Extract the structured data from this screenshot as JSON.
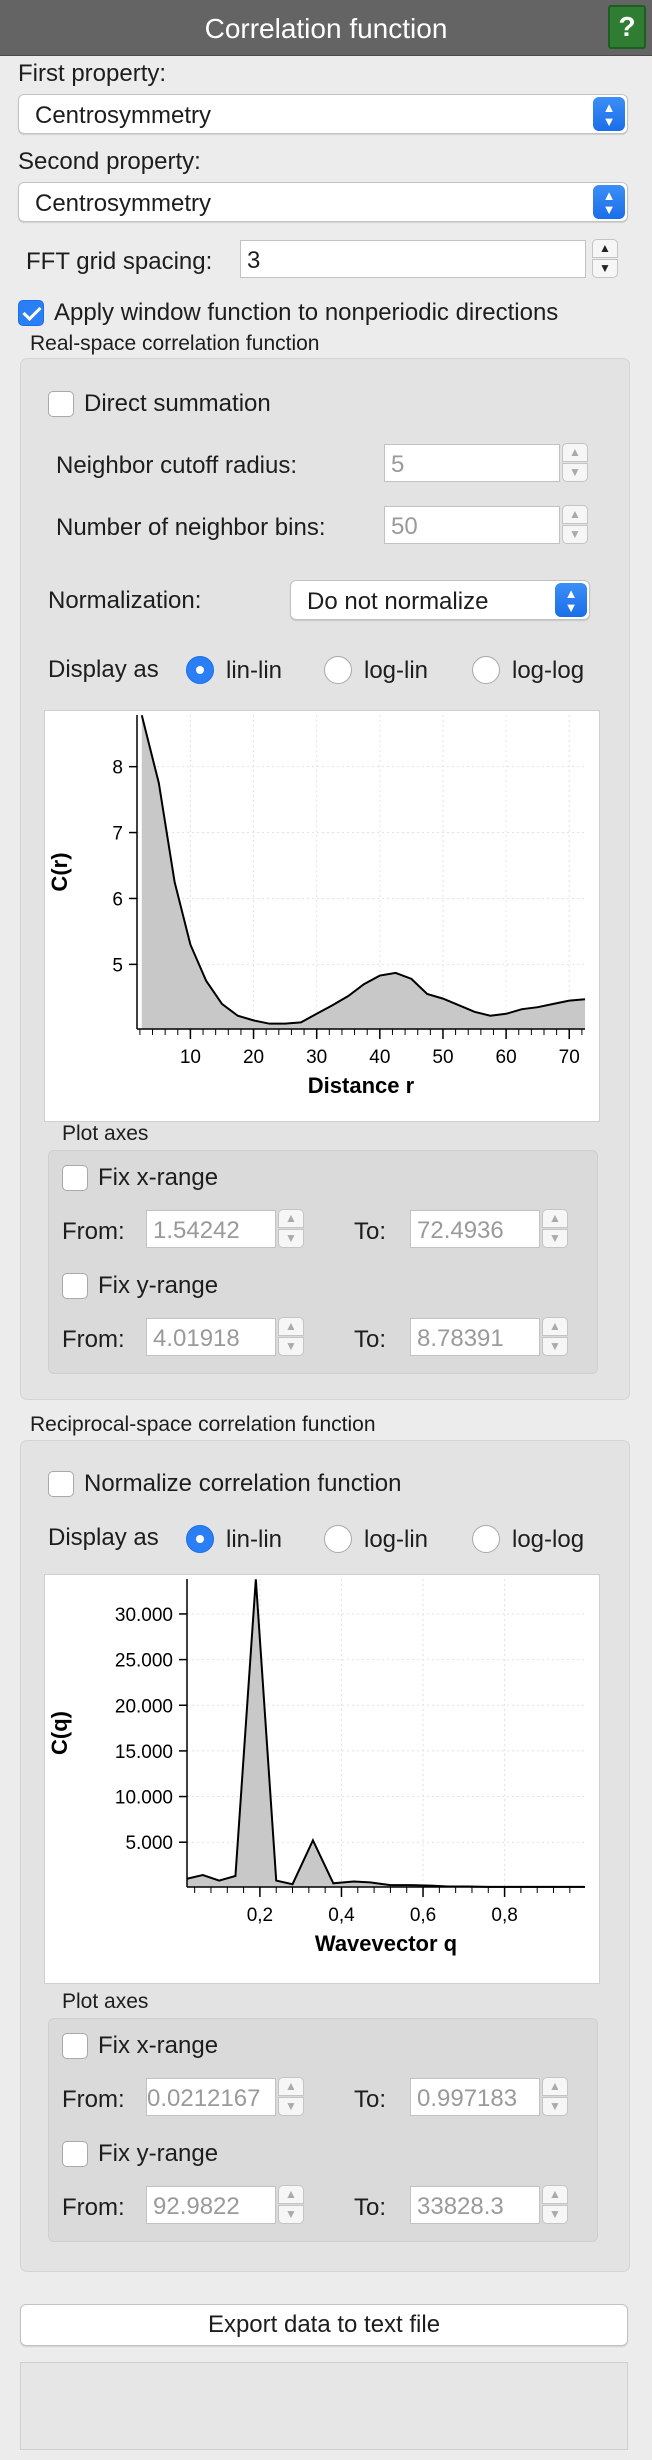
{
  "panel": {
    "title": "Correlation function",
    "help_label": "?"
  },
  "first_property": {
    "label": "First property:",
    "value": "Centrosymmetry"
  },
  "second_property": {
    "label": "Second property:",
    "value": "Centrosymmetry"
  },
  "fft": {
    "label": "FFT grid spacing:",
    "value": "3"
  },
  "apply_window": {
    "label": "Apply window function to nonperiodic directions",
    "checked": true
  },
  "real_space": {
    "title": "Real-space correlation function",
    "direct_summation": {
      "label": "Direct summation",
      "checked": false
    },
    "cutoff": {
      "label": "Neighbor cutoff radius:",
      "value": "5"
    },
    "bins": {
      "label": "Number of neighbor bins:",
      "value": "50"
    },
    "normalization": {
      "label": "Normalization:",
      "value": "Do not normalize"
    },
    "display": {
      "label": "Display as",
      "options": [
        "lin-lin",
        "log-lin",
        "log-log"
      ],
      "selected": "lin-lin"
    },
    "plot_axes": {
      "title": "Plot axes",
      "fix_x": "Fix x-range",
      "fix_y": "Fix y-range",
      "from_label": "From:",
      "to_label": "To:",
      "x_from": "1.54242",
      "x_to": "72.4936",
      "y_from": "4.01918",
      "y_to": "8.78391"
    }
  },
  "reciprocal_space": {
    "title": "Reciprocal-space correlation function",
    "normalize": {
      "label": "Normalize correlation function",
      "checked": false
    },
    "display": {
      "label": "Display as",
      "options": [
        "lin-lin",
        "log-lin",
        "log-log"
      ],
      "selected": "lin-lin"
    },
    "plot_axes": {
      "title": "Plot axes",
      "fix_x": "Fix x-range",
      "fix_y": "Fix y-range",
      "from_label": "From:",
      "to_label": "To:",
      "x_from": "0.0212167",
      "x_to": "0.997183",
      "y_from": "92.9822",
      "y_to": "33828.3"
    }
  },
  "export_button": "Export data to text file",
  "colors": {
    "accent": "#2b7ff5",
    "help": "#2e7d32",
    "fill": "#c8c8c8",
    "line": "#000000"
  },
  "chart_data": [
    {
      "type": "area",
      "title": "",
      "xlabel": "Distance r",
      "ylabel": "C(r)",
      "xlim": [
        1.54242,
        72.4936
      ],
      "ylim": [
        4.01918,
        8.78391
      ],
      "x_ticks": [
        10,
        20,
        30,
        40,
        50,
        60,
        70
      ],
      "y_ticks": [
        5,
        6,
        7,
        8
      ],
      "x_tick_labels": [
        "10",
        "20",
        "30",
        "40",
        "50",
        "60",
        "70"
      ],
      "y_tick_labels": [
        "5",
        "6",
        "7",
        "8"
      ],
      "grid": true,
      "x": [
        2.3,
        5.0,
        7.5,
        10.0,
        12.5,
        15.0,
        17.5,
        20.0,
        22.5,
        25.0,
        27.5,
        30.0,
        32.5,
        35.0,
        37.5,
        40.0,
        42.5,
        45.0,
        47.5,
        50.0,
        52.5,
        55.0,
        57.5,
        60.0,
        62.5,
        65.0,
        67.5,
        70.0,
        72.5
      ],
      "y": [
        8.78,
        7.75,
        6.25,
        5.3,
        4.75,
        4.4,
        4.22,
        4.15,
        4.1,
        4.1,
        4.12,
        4.25,
        4.38,
        4.52,
        4.7,
        4.83,
        4.87,
        4.78,
        4.55,
        4.48,
        4.38,
        4.28,
        4.22,
        4.25,
        4.32,
        4.35,
        4.4,
        4.45,
        4.47
      ]
    },
    {
      "type": "area",
      "title": "",
      "xlabel": "Wavevector q",
      "ylabel": "C(q)",
      "xlim": [
        0.0212167,
        0.997183
      ],
      "ylim": [
        92.9822,
        33828.3
      ],
      "x_ticks": [
        0.2,
        0.4,
        0.6,
        0.8
      ],
      "y_ticks": [
        5000,
        10000,
        15000,
        20000,
        25000,
        30000
      ],
      "x_tick_labels": [
        "0,2",
        "0,4",
        "0,6",
        "0,8"
      ],
      "y_tick_labels": [
        "5.000",
        "10.000",
        "15.000",
        "20.000",
        "25.000",
        "30.000"
      ],
      "grid": true,
      "x": [
        0.021,
        0.06,
        0.1,
        0.14,
        0.19,
        0.24,
        0.28,
        0.33,
        0.38,
        0.43,
        0.47,
        0.52,
        0.57,
        0.62,
        0.66,
        0.71,
        0.76,
        0.8,
        0.85,
        0.9,
        0.95,
        0.997
      ],
      "y": [
        1000,
        1400,
        800,
        1300,
        33800,
        800,
        400,
        5200,
        500,
        700,
        600,
        300,
        300,
        250,
        150,
        150,
        100,
        100,
        100,
        100,
        100,
        100
      ]
    }
  ]
}
